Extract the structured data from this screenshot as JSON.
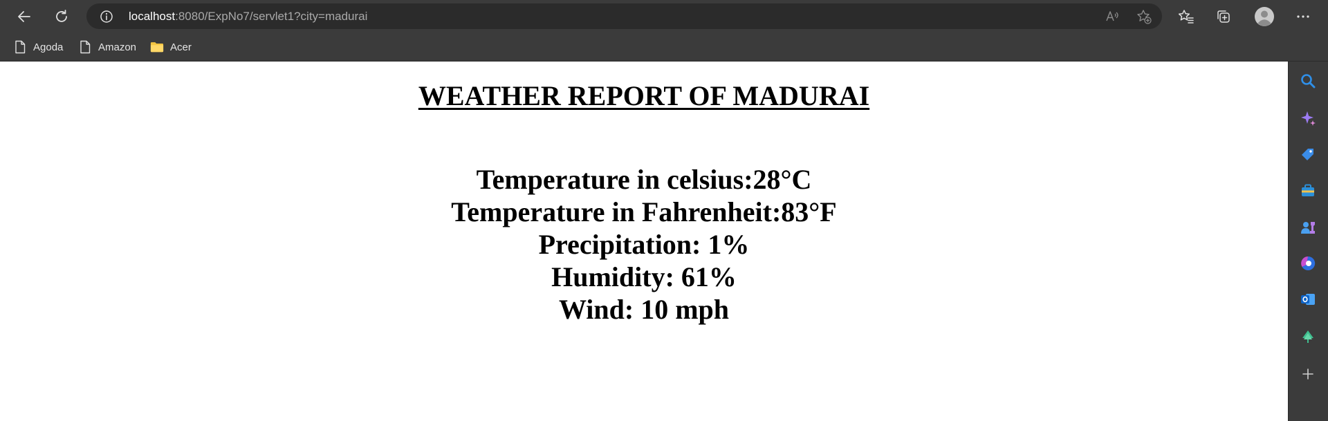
{
  "browser": {
    "address_bar": {
      "host": "localhost",
      "path": ":8080/ExpNo7/servlet1?city=madurai"
    },
    "favorites": [
      {
        "label": "Agoda",
        "icon": "page-icon"
      },
      {
        "label": "Amazon",
        "icon": "page-icon"
      },
      {
        "label": "Acer",
        "icon": "folder-icon"
      }
    ],
    "toolbar_icons": [
      "back-icon",
      "refresh-icon",
      "site-info-icon",
      "read-aloud-icon",
      "add-favorite-icon",
      "favorites-icon",
      "collections-icon",
      "profile-icon",
      "more-icon"
    ],
    "sidebar_icons": [
      "search-icon",
      "copilot-icon",
      "shopping-icon",
      "tools-icon",
      "games-icon",
      "microsoft-365-icon",
      "outlook-icon",
      "drop-icon",
      "add-icon"
    ],
    "colors": {
      "toolbar_bg": "#3b3b3b",
      "address_bg": "#2b2b2b",
      "page_bg": "#ffffff",
      "text": "#000000"
    }
  },
  "page": {
    "title": "WEATHER REPORT OF MADURAI",
    "report": {
      "temperature_c": "Temperature in celsius:28°C",
      "temperature_f": "Temperature in Fahrenheit:83°F",
      "precipitation": "Precipitation: 1%",
      "humidity": "Humidity: 61%",
      "wind": "Wind: 10 mph"
    }
  }
}
